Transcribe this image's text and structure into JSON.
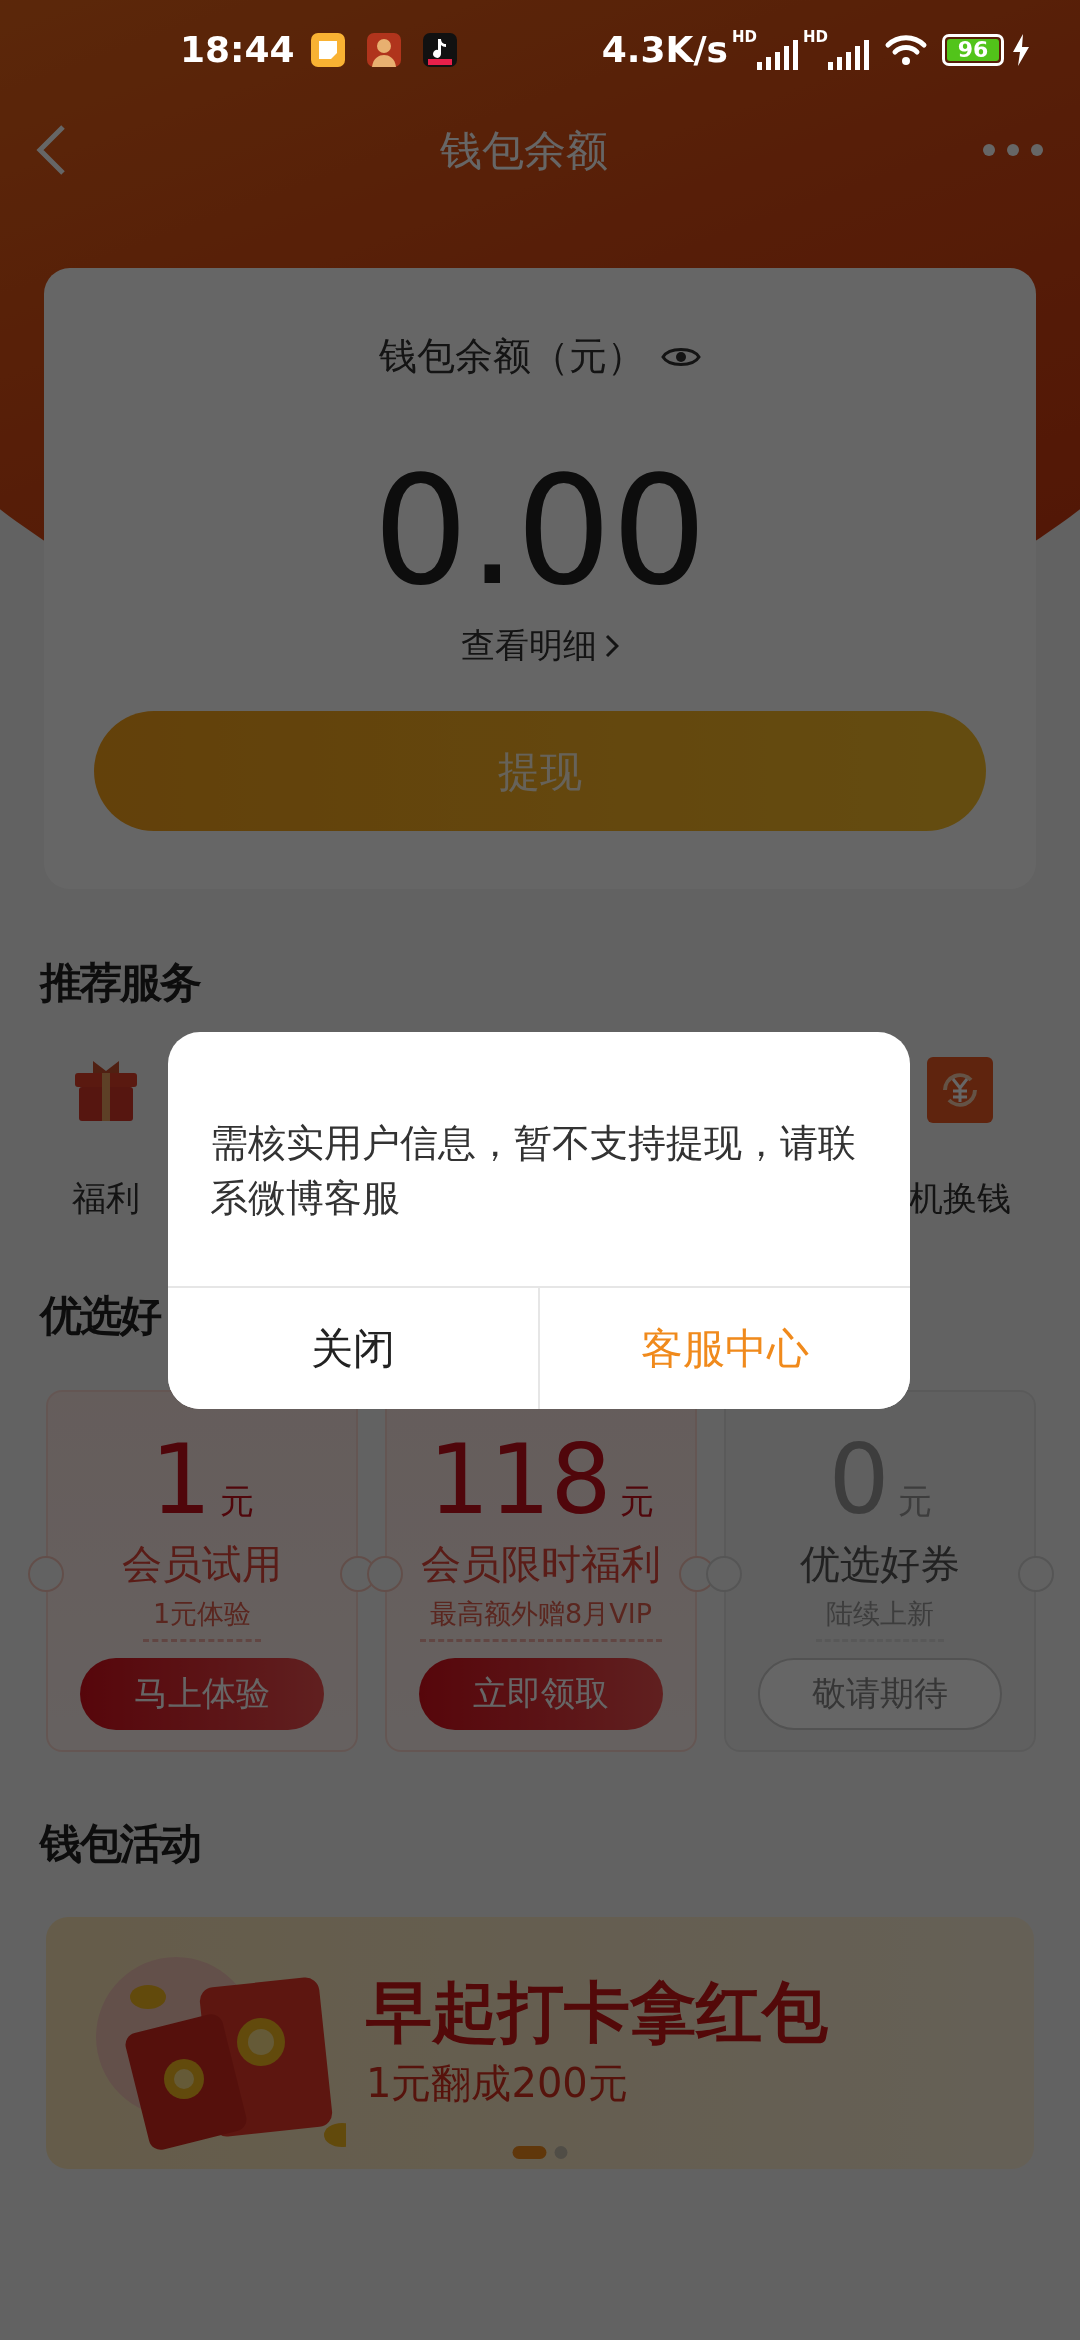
{
  "status_bar": {
    "time": "18:44",
    "network_speed": "4.3K/s",
    "signal_labels": [
      "HD",
      "HD"
    ],
    "battery": "96",
    "charging": true
  },
  "header": {
    "title": "钱包余额"
  },
  "balance_card": {
    "label": "钱包余额（元）",
    "amount": "0.00",
    "details_link": "查看明细",
    "withdraw_button": "提现"
  },
  "recommended": {
    "title": "推荐服务",
    "items": [
      {
        "label": "福利",
        "kind": "gift"
      },
      {
        "label": "机换钱",
        "kind": "exchange"
      }
    ]
  },
  "coupons": {
    "title": "优选好",
    "items": [
      {
        "amount": "1",
        "unit": "元",
        "name": "会员试用",
        "desc": "1元体验",
        "button": "马上体验",
        "disabled": false
      },
      {
        "amount": "118",
        "unit": "元",
        "name": "会员限时福利",
        "desc": "最高额外赠8月VIP",
        "button": "立即领取",
        "disabled": false
      },
      {
        "amount": "0",
        "unit": "元",
        "name": "优选好券",
        "desc": "陆续上新",
        "button": "敬请期待",
        "disabled": true
      }
    ]
  },
  "activities": {
    "title": "钱包活动",
    "banner": {
      "title": "早起打卡拿红包",
      "subtitle": "1元翻成200元"
    },
    "pager": [
      {
        "selected": true
      },
      {
        "selected": false
      }
    ]
  },
  "dialog": {
    "message": "需核实用户信息，暂不支持提现，请联系微博客服",
    "buttons": [
      {
        "label": "关闭",
        "kind": "default"
      },
      {
        "label": "客服中心",
        "kind": "primary"
      }
    ]
  }
}
